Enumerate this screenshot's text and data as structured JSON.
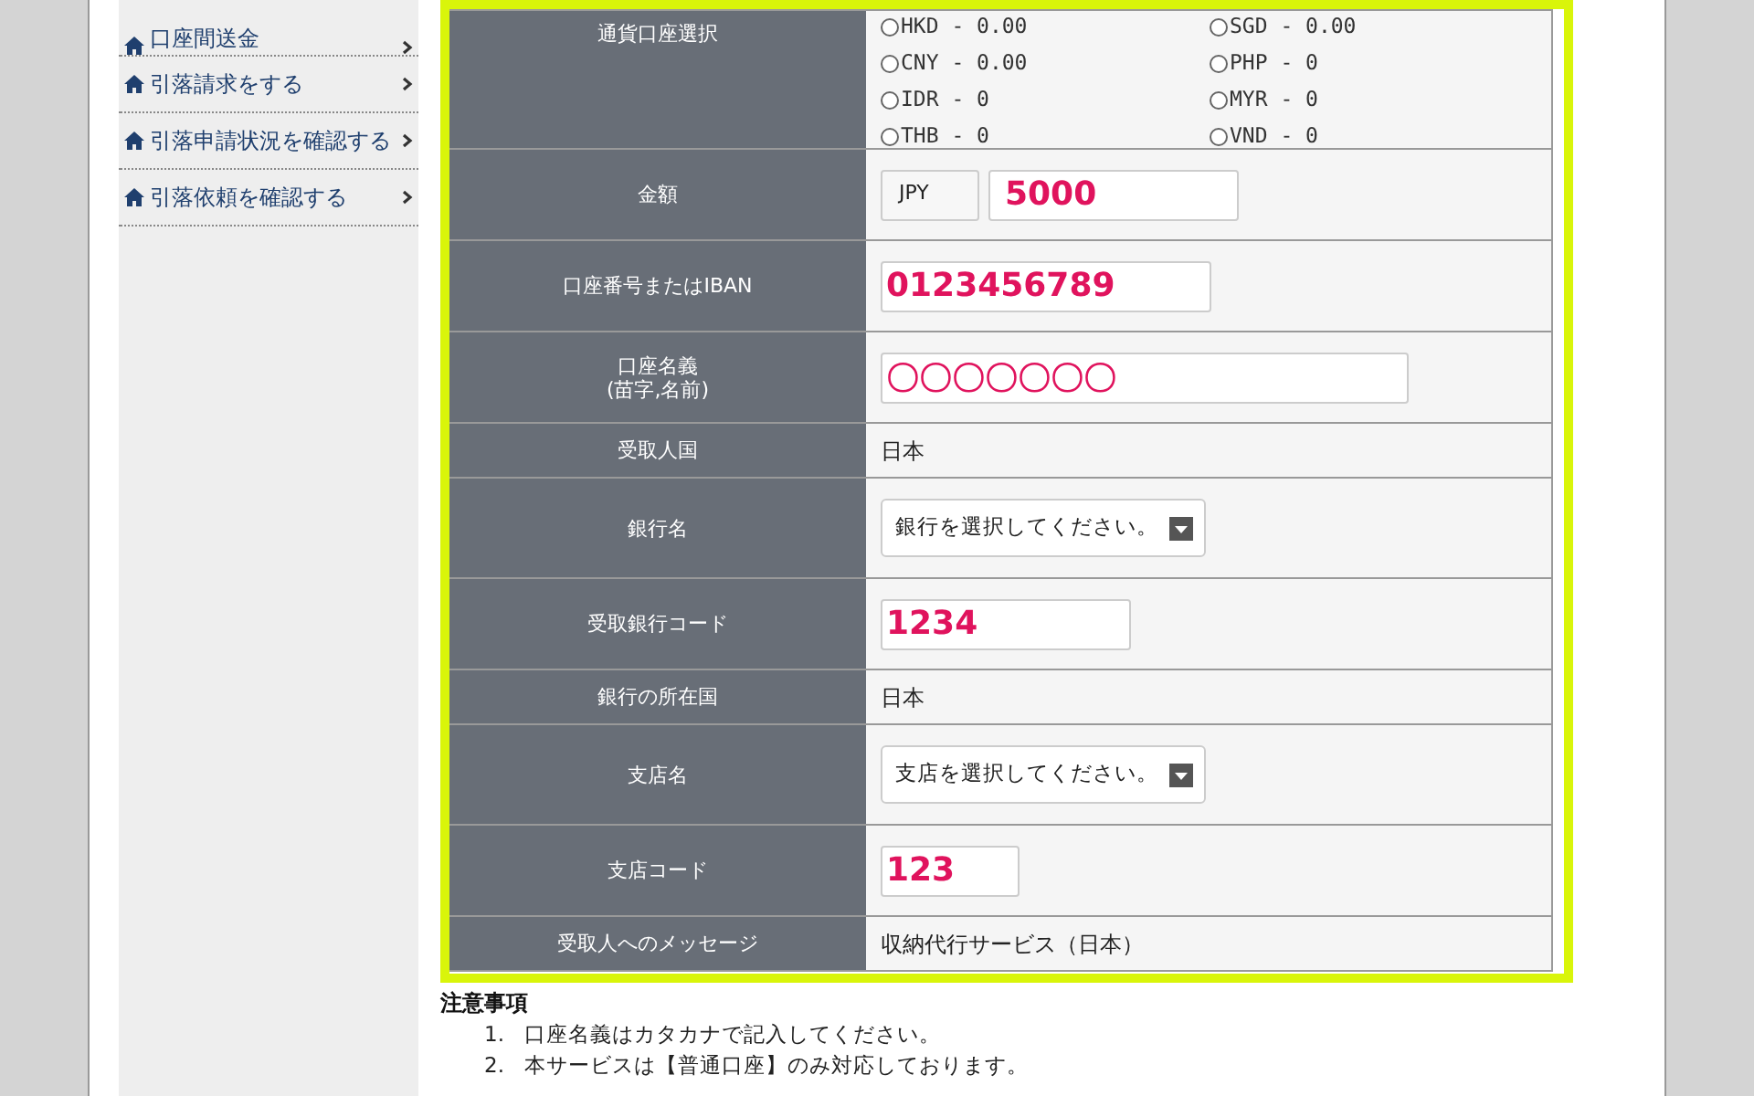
{
  "sidebar": {
    "items": [
      {
        "label": "口座間送金"
      },
      {
        "label": "引落請求をする"
      },
      {
        "label": "引落申請状況を確認する"
      },
      {
        "label": "引落依頼を確認する"
      }
    ]
  },
  "form": {
    "rows": [
      {
        "kind": "radios",
        "label": "通貨口座選択",
        "options": [
          {
            "label": "HKD - 0.00",
            "selected": false
          },
          {
            "label": "SGD - 0.00",
            "selected": false
          },
          {
            "label": "CNY - 0.00",
            "selected": false
          },
          {
            "label": "PHP - 0",
            "selected": false
          },
          {
            "label": "IDR - 0",
            "selected": false
          },
          {
            "label": "MYR - 0",
            "selected": false
          },
          {
            "label": "THB - 0",
            "selected": false
          },
          {
            "label": "VND - 0",
            "selected": false
          }
        ]
      },
      {
        "kind": "amount",
        "label": "金額",
        "currency": "JPY",
        "value": "5000"
      },
      {
        "kind": "input",
        "label": "口座番号またはIBAN",
        "value": "0123456789"
      },
      {
        "kind": "input",
        "label": "口座名義\n(苗字,名前)",
        "value": "〇〇〇〇〇〇〇"
      },
      {
        "kind": "text",
        "label": "受取人国",
        "value": "日本"
      },
      {
        "kind": "select",
        "label": "銀行名",
        "value": "銀行を選択してください。"
      },
      {
        "kind": "input",
        "label": "受取銀行コード",
        "value": "1234"
      },
      {
        "kind": "text",
        "label": "銀行の所在国",
        "value": "日本"
      },
      {
        "kind": "select",
        "label": "支店名",
        "value": "支店を選択してください。"
      },
      {
        "kind": "input",
        "label": "支店コード",
        "value": "123"
      },
      {
        "kind": "text",
        "label": "受取人へのメッセージ",
        "value": "収納代行サービス（日本）"
      }
    ]
  },
  "notes": {
    "title": "注意事項",
    "items": [
      {
        "number": "1.",
        "text": "口座名義はカタカナで記入してください。"
      },
      {
        "number": "2.",
        "text": "本サービスは【普通口座】のみ対応しております。"
      }
    ]
  }
}
